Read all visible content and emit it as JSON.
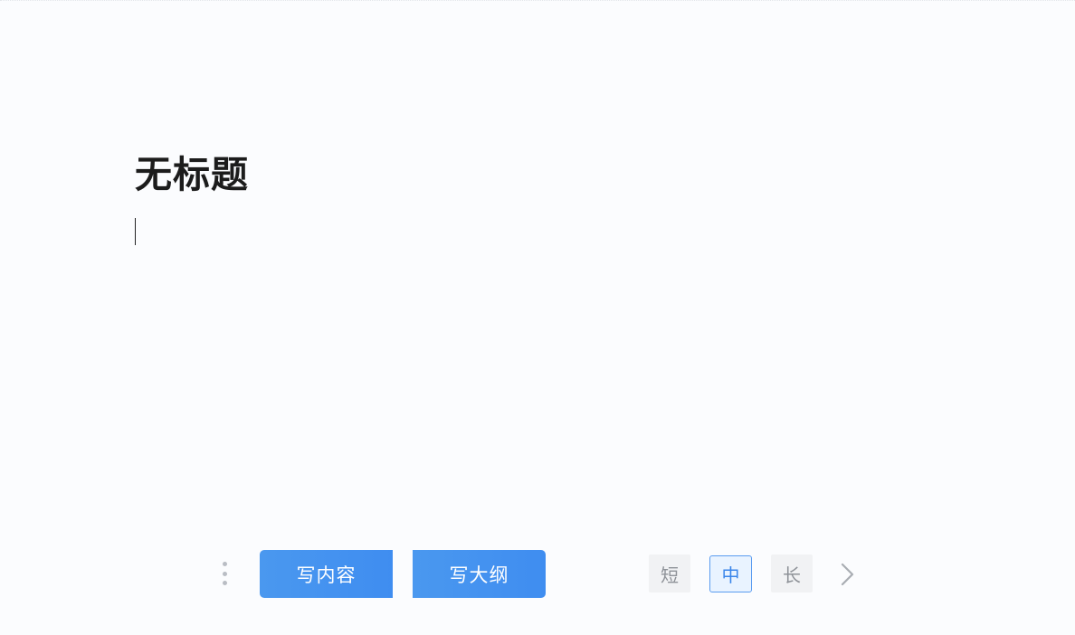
{
  "document": {
    "title": "无标题"
  },
  "actions": {
    "write_content_label": "写内容",
    "write_outline_label": "写大纲"
  },
  "length_options": {
    "short_label": "短",
    "medium_label": "中",
    "long_label": "长",
    "selected": "中"
  },
  "icons": {
    "drag_handle": "drag-handle-icon",
    "next": "chevron-right-icon"
  },
  "colors": {
    "primary_button": "#4a98ef",
    "selected_border": "#5a9cf0",
    "selected_text": "#3b86ea",
    "title_text": "#1c1c1c",
    "background": "#fbfcfe"
  }
}
